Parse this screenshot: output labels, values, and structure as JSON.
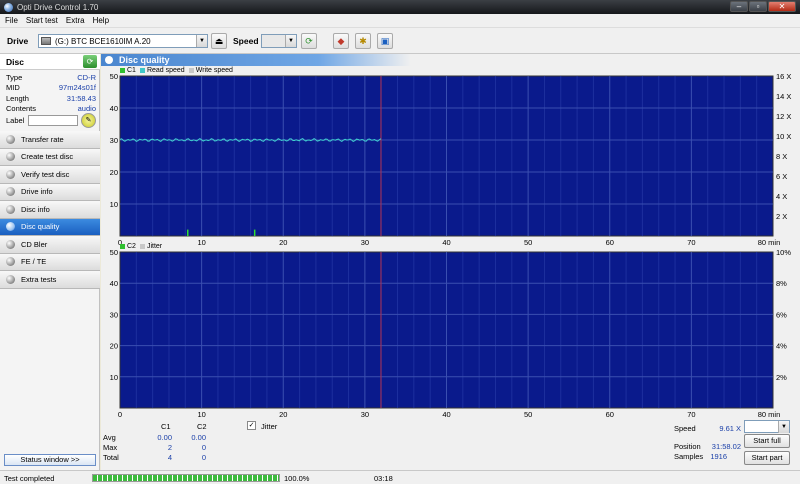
{
  "window": {
    "title": "Opti Drive Control 1.70"
  },
  "menu": [
    "File",
    "Start test",
    "Extra",
    "Help"
  ],
  "toolbar": {
    "drive_label": "Drive",
    "drive_value": "(G:)  BTC BCE1610IM A.20",
    "speed_label": "Speed",
    "speed_value": ""
  },
  "disc": {
    "header": "Disc",
    "type_k": "Type",
    "type_v": "CD-R",
    "mid_k": "MID",
    "mid_v": "97m24s01f",
    "length_k": "Length",
    "length_v": "31:58.43",
    "contents_k": "Contents",
    "contents_v": "audio",
    "label_k": "Label"
  },
  "nav": [
    "Transfer rate",
    "Create test disc",
    "Verify test disc",
    "Drive info",
    "Disc info",
    "Disc quality",
    "CD Bler",
    "FE / TE",
    "Extra tests"
  ],
  "nav_active_index": 5,
  "status_window_btn": "Status window >>",
  "panel": {
    "title": "Disc quality"
  },
  "chart_data": [
    {
      "type": "line",
      "legend": [
        "C1",
        "Read speed",
        "Write speed"
      ],
      "x_ticks": [
        "0",
        "10",
        "20",
        "30",
        "40",
        "50",
        "60",
        "70",
        "80 min"
      ],
      "y_ticks": [
        "10",
        "20",
        "30",
        "40",
        "50"
      ],
      "y2_ticks": [
        "2 X",
        "4 X",
        "6 X",
        "8 X",
        "10 X",
        "12 X",
        "14 X",
        "16 X"
      ],
      "xlim": [
        0,
        80
      ],
      "ylim": [
        0,
        50
      ],
      "y2lim": [
        0,
        16
      ],
      "read_speed_level": 30,
      "c1_spikes": [
        [
          8.3,
          2
        ],
        [
          16.5,
          2
        ]
      ],
      "disc_end_min": 31.97
    },
    {
      "type": "line",
      "legend": [
        "C2",
        "Jitter"
      ],
      "x_ticks": [
        "0",
        "10",
        "20",
        "30",
        "40",
        "50",
        "60",
        "70",
        "80 min"
      ],
      "y_ticks": [
        "10",
        "20",
        "30",
        "40",
        "50"
      ],
      "y2_ticks": [
        "2%",
        "4%",
        "6%",
        "8%",
        "10%"
      ],
      "xlim": [
        0,
        80
      ],
      "ylim": [
        0,
        50
      ],
      "y2lim": [
        0,
        10
      ],
      "disc_end_min": 31.97
    }
  ],
  "stats": {
    "c1_header": "C1",
    "c2_header": "C2",
    "avg_label": "Avg",
    "max_label": "Max",
    "total_label": "Total",
    "c1_avg": "0.00",
    "c2_avg": "0.00",
    "c1_max": "2",
    "c2_max": "0",
    "c1_total": "4",
    "c2_total": "0",
    "jitter_label": "Jitter",
    "speed_label": "Speed",
    "speed_value": "9.61 X",
    "position_label": "Position",
    "position_value": "31:58.02",
    "samples_label": "Samples",
    "samples_value": "1916",
    "start_full": "Start full",
    "start_part": "Start part"
  },
  "statusbar": {
    "text": "Test completed",
    "progress_percent": 100,
    "progress_text": "100.0%",
    "elapsed": "03:18"
  }
}
